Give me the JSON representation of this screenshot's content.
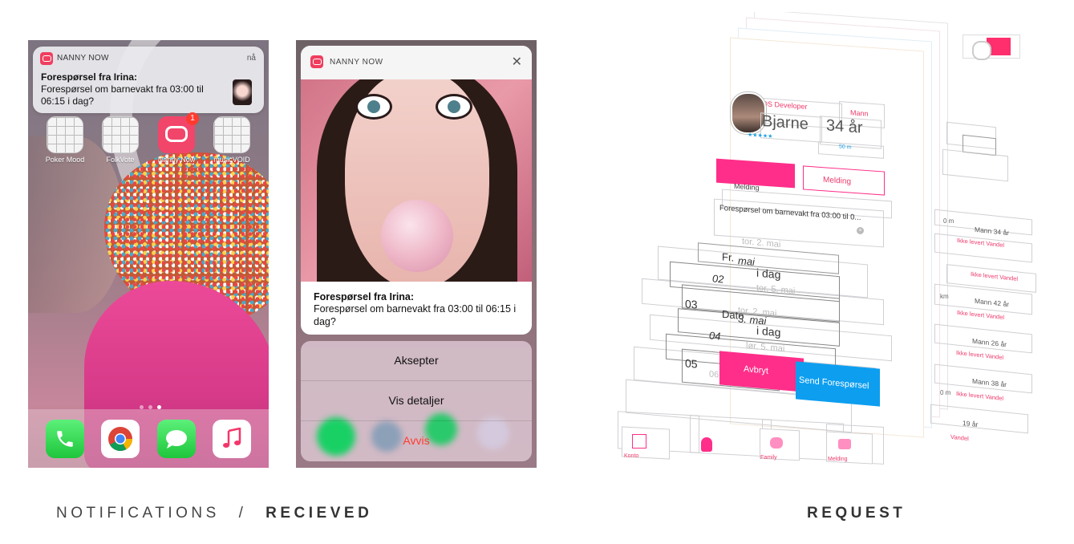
{
  "home": {
    "notification": {
      "app_name": "NANNY NOW",
      "time": "nå",
      "title": "Forespørsel fra Irina:",
      "body": "Forespørsel om barnevakt fra 03:00 til 06:15 i dag?"
    },
    "apps": [
      {
        "label": "Poker Mood"
      },
      {
        "label": "FolkVote"
      },
      {
        "label": "Nanny Now",
        "badge": "1"
      },
      {
        "label": "musicVOID"
      }
    ],
    "dock": [
      "phone-icon",
      "chrome-icon",
      "messages-icon",
      "music-icon"
    ]
  },
  "received": {
    "app_name": "NANNY NOW",
    "close_icon": "close-icon",
    "title": "Forespørsel fra Irina:",
    "body": "Forespørsel om barnevakt fra 03:00 til 06:15 i dag?",
    "actions": {
      "accept": "Aksepter",
      "details": "Vis detaljer",
      "reject": "Avvis"
    }
  },
  "request": {
    "profile": {
      "role": "iOS Developer",
      "gender": "Mann",
      "name": "Bjarne",
      "age": "34 år",
      "rating": "★★★★★",
      "distance": "50 m"
    },
    "tab_message": "Melding",
    "message_label": "Melding",
    "message_text": "Forespørsel om barnevakt fra 03:00 til 0...",
    "picker": {
      "date_rows": [
        "tor. 2. mai",
        "Fr.",
        "mai",
        "i dag",
        "tor. 5. mai",
        "tor. 2. mai",
        "Dato",
        "3. mai",
        "i dag",
        "lør. 5. mai"
      ],
      "hours": [
        "02",
        "03",
        "04",
        "05",
        "06"
      ]
    },
    "cancel": "Avbryt",
    "send": "Send Forespørsel",
    "list": [
      {
        "meta": "Mann 34 år",
        "status": "Ikke levert Vandel"
      },
      {
        "meta": "",
        "status": "Ikke levert Vandel"
      },
      {
        "meta": "Mann 42 år",
        "status": "Ikke levert Vandel"
      },
      {
        "meta": "Mann 26 år",
        "status": "Ikke levert Vandel"
      },
      {
        "meta": "Mann 38 år",
        "status": "Ikke levert Vandel"
      },
      {
        "meta": "19 år",
        "status": "Vandel"
      }
    ],
    "list_frag": [
      "0 m",
      "km",
      "0 m"
    ],
    "tabbar": [
      "Konto",
      "",
      "Family",
      "Melding"
    ],
    "colors": {
      "pink": "#ff2e8a",
      "blue": "#0d9ef0"
    }
  },
  "captions": {
    "left_a": "NOTIFICATIONS",
    "left_sep": "/",
    "left_b": "RECIEVED",
    "right": "REQUEST"
  }
}
